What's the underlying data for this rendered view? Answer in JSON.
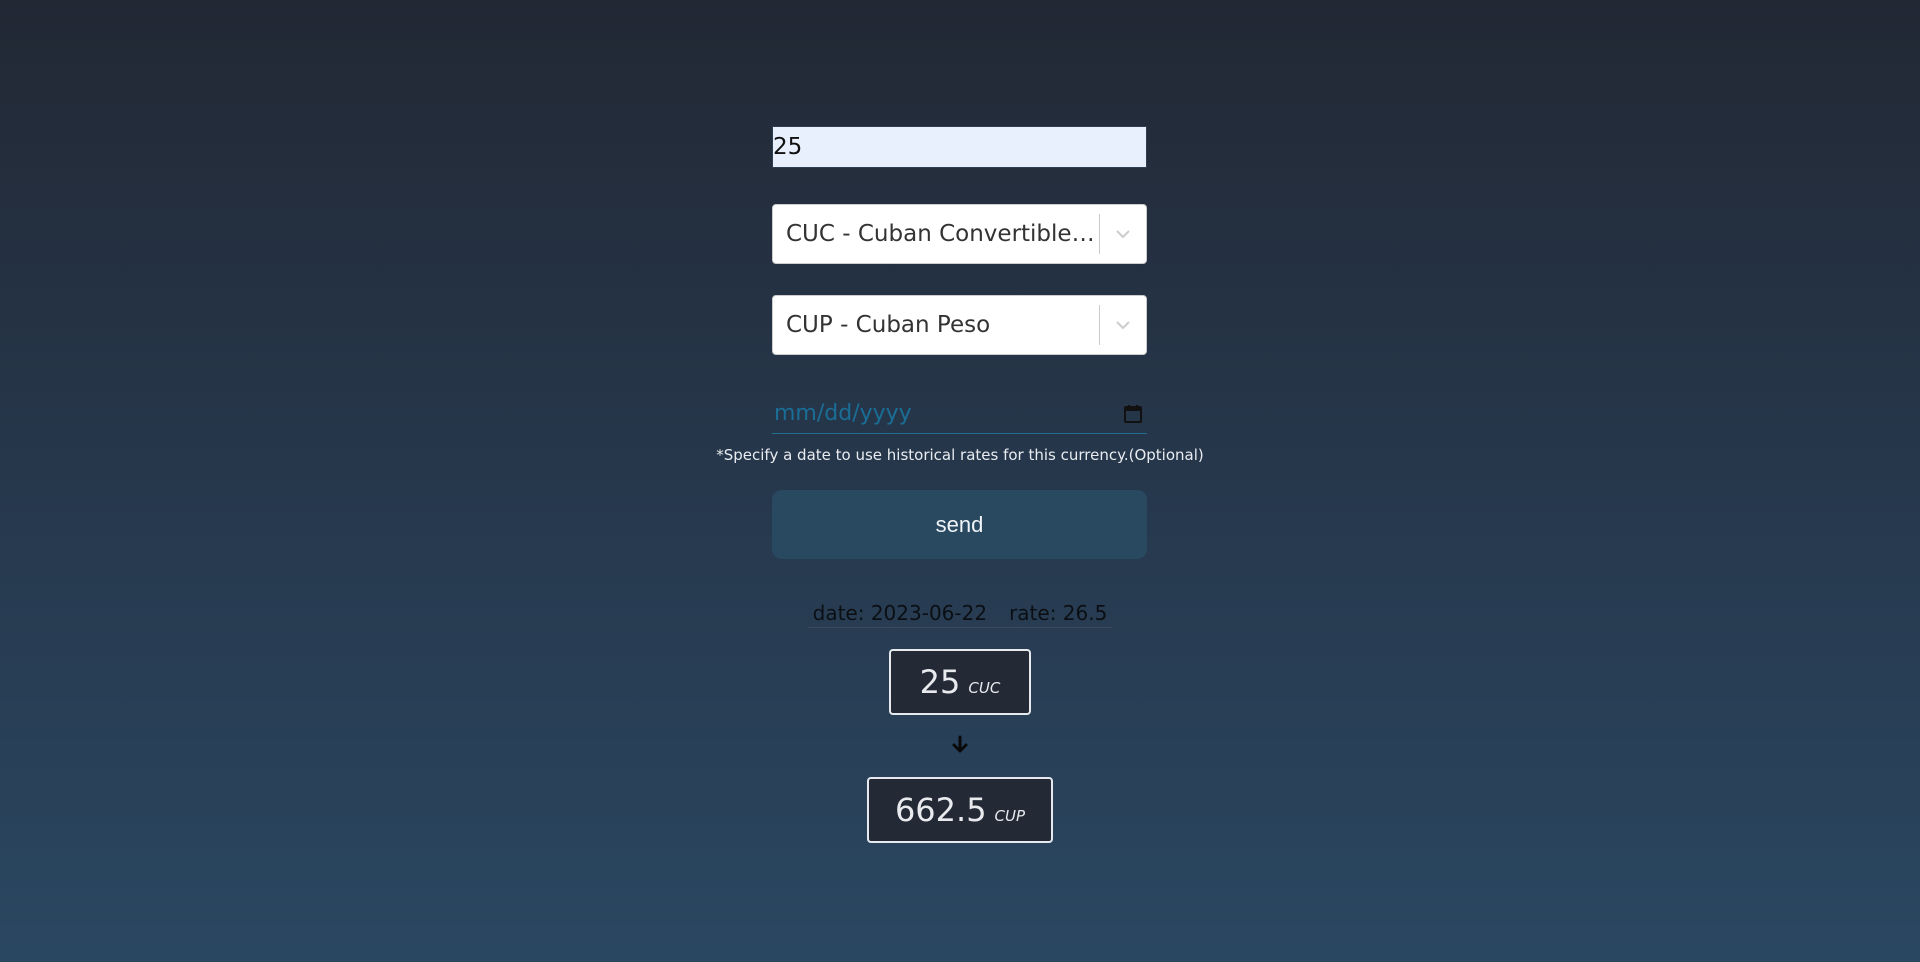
{
  "form": {
    "amount_value": "25",
    "from_currency": "CUC - Cuban Convertible Peso",
    "to_currency": "CUP - Cuban Peso",
    "date_placeholder": "mm/dd/yyyy",
    "hint": "*Specify a date to use historical rates for this currency.(Optional)",
    "send_label": "send"
  },
  "result": {
    "date_text": "date: 2023-06-22",
    "rate_text": "rate: 26.5",
    "from_amount": "25",
    "from_code": "CUC",
    "to_amount": "662.5",
    "to_code": "CUP"
  },
  "icons": {
    "select_chevron": "chevron-down-icon",
    "date_picker": "calendar-icon",
    "conversion_arrow": "arrow-down-icon"
  },
  "colors": {
    "background_top": "#222834",
    "background_bottom": "#2a4761",
    "button": "#294961",
    "input_fill": "#e8f0fe",
    "date_placeholder": "#1a6e96"
  }
}
